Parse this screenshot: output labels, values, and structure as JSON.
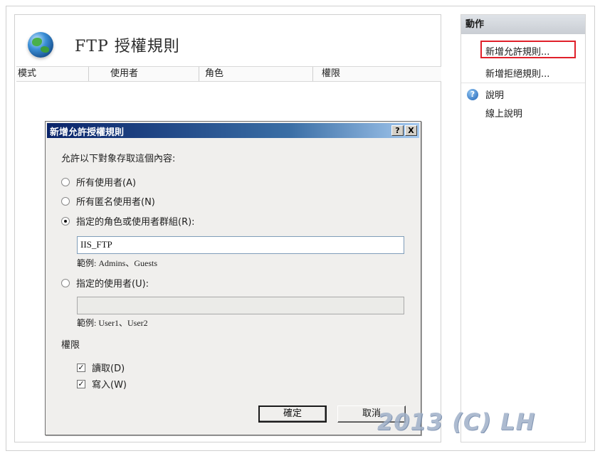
{
  "main": {
    "title": "FTP 授權規則",
    "columns": [
      "模式",
      "使用者",
      "角色",
      "權限"
    ]
  },
  "actions": {
    "header": "動作",
    "add_allow": "新增允許規則...",
    "add_deny": "新增拒絕規則...",
    "help": "說明",
    "online_help": "線上說明"
  },
  "dialog": {
    "title": "新增允許授權規則",
    "help_btn": "?",
    "close_btn": "X",
    "prompt": "允許以下對象存取這個內容:",
    "options": [
      {
        "label": "所有使用者(A)",
        "selected": false
      },
      {
        "label": "所有匿名使用者(N)",
        "selected": false
      },
      {
        "label": "指定的角色或使用者群組(R):",
        "selected": true
      },
      {
        "label": "指定的使用者(U):",
        "selected": false
      }
    ],
    "roles_value": "IIS_FTP",
    "roles_example": "範例: Admins、Guests",
    "users_value": "",
    "users_example": "範例: User1、User2",
    "permissions_label": "權限",
    "perm_read": {
      "label": "讀取(D)",
      "checked": true
    },
    "perm_write": {
      "label": "寫入(W)",
      "checked": true
    },
    "ok": "確定",
    "cancel": "取消"
  },
  "watermark": "2013 (C) LH",
  "colors": {
    "highlight": "#e0202a",
    "titlebar": "#0a246a"
  }
}
